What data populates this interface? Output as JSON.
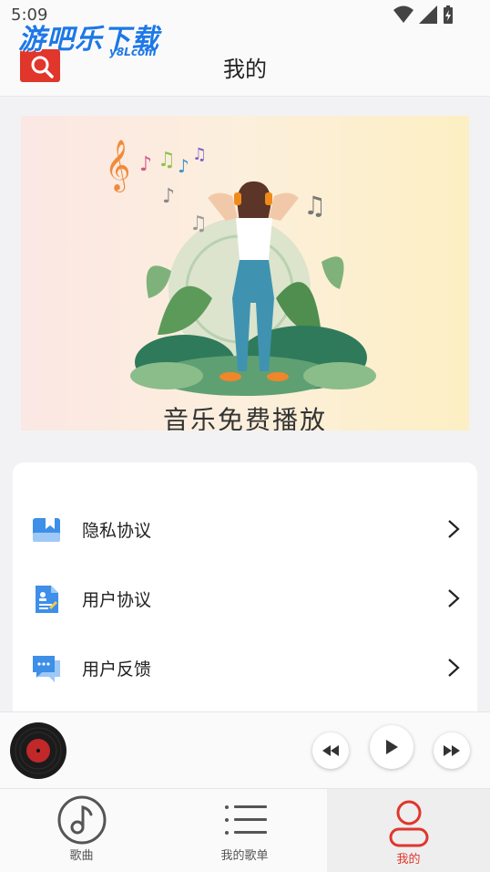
{
  "status_bar": {
    "time": "5:09"
  },
  "watermark": {
    "text": "游吧乐下载",
    "sub": "y8Lcom"
  },
  "header": {
    "title": "我的"
  },
  "banner": {
    "caption": "音乐免费播放"
  },
  "menu": {
    "items": [
      {
        "label": "隐私协议",
        "icon": "bookmark-doc-icon"
      },
      {
        "label": "用户协议",
        "icon": "user-doc-icon"
      },
      {
        "label": "用户反馈",
        "icon": "chat-bubble-icon"
      }
    ]
  },
  "bottom_nav": {
    "tabs": [
      {
        "label": "歌曲",
        "icon": "music-note-icon"
      },
      {
        "label": "我的歌单",
        "icon": "list-icon"
      },
      {
        "label": "我的",
        "icon": "user-icon",
        "active": true
      }
    ]
  },
  "colors": {
    "accent": "#e0362c",
    "menu_icon_blue": "#3d8fe8",
    "watermark_blue": "#1e78e6"
  }
}
